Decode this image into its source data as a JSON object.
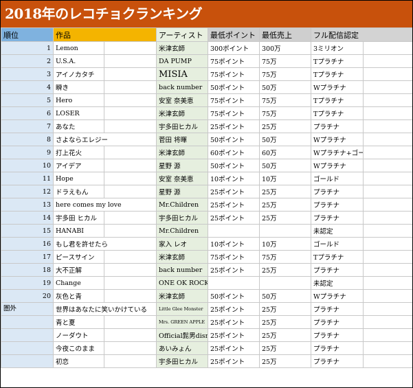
{
  "title": "2018年のレコチョクランキング",
  "headers": {
    "rank": "順位",
    "work": "作品",
    "artist": "アーティスト",
    "min_points": "最低ポイント",
    "min_sales": "最低売上",
    "cert": "フル配信認定"
  },
  "rows": [
    {
      "rank": "1",
      "work": "Lemon",
      "artist": "米津玄師",
      "points": "300ポイント",
      "sales": "300万",
      "cert": "3ミリオン"
    },
    {
      "rank": "2",
      "work": "U.S.A.",
      "artist": "DA PUMP",
      "points": "75ポイント",
      "sales": "75万",
      "cert": "Tプラチナ"
    },
    {
      "rank": "3",
      "work": "アイノカタチ",
      "artist": "MISIA",
      "points": "75ポイント",
      "sales": "75万",
      "cert": "Tプラチナ"
    },
    {
      "rank": "4",
      "work": "瞬き",
      "artist": "back number",
      "points": "50ポイント",
      "sales": "50万",
      "cert": "Wプラチナ"
    },
    {
      "rank": "5",
      "work": "Hero",
      "artist": "安室 奈美恵",
      "points": "75ポイント",
      "sales": "75万",
      "cert": "Tプラチナ"
    },
    {
      "rank": "6",
      "work": "LOSER",
      "artist": "米津玄師",
      "points": "75ポイント",
      "sales": "75万",
      "cert": "Tプラチナ"
    },
    {
      "rank": "7",
      "work": "あなた",
      "artist": "宇多田ヒカル",
      "points": "25ポイント",
      "sales": "25万",
      "cert": "プラチナ"
    },
    {
      "rank": "8",
      "work": "さよならエレジー",
      "artist": "菅田 将暉",
      "points": "50ポイント",
      "sales": "50万",
      "cert": "Wプラチナ"
    },
    {
      "rank": "9",
      "work": "打上花火",
      "artist": "米津玄師",
      "points": "60ポイント",
      "sales": "60万",
      "cert": "Wプラチナ+ゴールド"
    },
    {
      "rank": "10",
      "work": "アイデア",
      "artist": "星野 源",
      "points": "50ポイント",
      "sales": "50万",
      "cert": "Wプラチナ"
    },
    {
      "rank": "11",
      "work": "Hope",
      "artist": "安室 奈美恵",
      "points": "10ポイント",
      "sales": "10万",
      "cert": "ゴールド"
    },
    {
      "rank": "12",
      "work": "ドラえもん",
      "artist": "星野 源",
      "points": "25ポイント",
      "sales": "25万",
      "cert": "プラチナ"
    },
    {
      "rank": "13",
      "work": "here comes my love",
      "artist": "Mr.Children",
      "points": "25ポイント",
      "sales": "25万",
      "cert": "プラチナ"
    },
    {
      "rank": "14",
      "work": "宇多田 ヒカル",
      "artist": "宇多田ヒカル",
      "points": "25ポイント",
      "sales": "25万",
      "cert": "プラチナ"
    },
    {
      "rank": "15",
      "work": "HANABI",
      "artist": "Mr.Children",
      "points": "",
      "sales": "",
      "cert": "未認定"
    },
    {
      "rank": "16",
      "work": "もし君を許せたら",
      "artist": "家入 レオ",
      "points": "10ポイント",
      "sales": "10万",
      "cert": "ゴールド"
    },
    {
      "rank": "17",
      "work": "ピースサイン",
      "artist": "米津玄師",
      "points": "75ポイント",
      "sales": "75万",
      "cert": "Tプラチナ"
    },
    {
      "rank": "18",
      "work": "大不正解",
      "artist": "back number",
      "points": "25ポイント",
      "sales": "25万",
      "cert": "プラチナ"
    },
    {
      "rank": "19",
      "work": "Change",
      "artist": "ONE OK ROCK",
      "points": "",
      "sales": "",
      "cert": "未認定"
    },
    {
      "rank": "20",
      "work": "灰色と青",
      "artist": "米津玄師",
      "points": "50ポイント",
      "sales": "50万",
      "cert": "Wプラチナ"
    }
  ],
  "out_label": "圏外",
  "out_rows": [
    {
      "work": "世界はあなたに笑いかけている",
      "artist": "Little Glee Monster",
      "points": "25ポイント",
      "sales": "25万",
      "cert": "プラチナ"
    },
    {
      "work": "青と夏",
      "artist": "Mrs. GREEN APPLE",
      "points": "25ポイント",
      "sales": "25万",
      "cert": "プラチナ"
    },
    {
      "work": "ノーダウト",
      "artist": "Official髭男dism",
      "points": "25ポイント",
      "sales": "25万",
      "cert": "プラチナ"
    },
    {
      "work": "今夜このまま",
      "artist": "あいみょん",
      "points": "25ポイント",
      "sales": "25万",
      "cert": "プラチナ"
    },
    {
      "work": "初恋",
      "artist": "宇多田ヒカル",
      "points": "25ポイント",
      "sales": "25万",
      "cert": "プラチナ"
    }
  ]
}
